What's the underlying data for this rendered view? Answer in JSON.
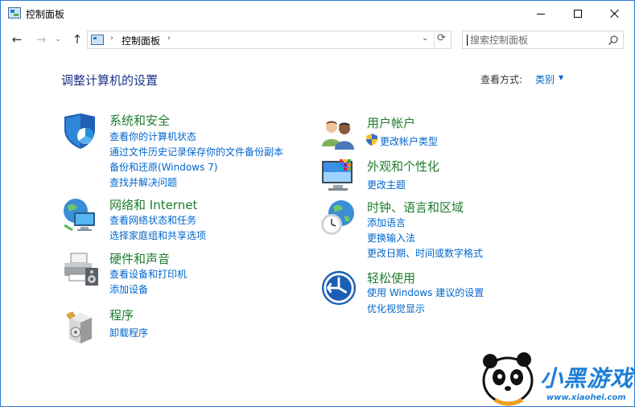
{
  "window": {
    "title": "控制面板"
  },
  "nav": {
    "back": "←",
    "forward": "→",
    "recent": "⌄",
    "up": "↑"
  },
  "address": {
    "separator": "›",
    "crumb": "控制面板",
    "dropdown": "⌄",
    "refresh": "⟳"
  },
  "search": {
    "placeholder": "搜索控制面板"
  },
  "header": {
    "title": "调整计算机的设置",
    "viewby_label": "查看方式:",
    "viewby_value": "类别",
    "viewby_arrow": "▼"
  },
  "categories": [
    {
      "title": "系统和安全",
      "links": [
        "查看你的计算机状态",
        "通过文件历史记录保存你的文件备份副本",
        "备份和还原(Windows 7)",
        "查找并解决问题"
      ]
    },
    {
      "title": "网络和 Internet",
      "links": [
        "查看网络状态和任务",
        "选择家庭组和共享选项"
      ]
    },
    {
      "title": "硬件和声音",
      "links": [
        "查看设备和打印机",
        "添加设备"
      ]
    },
    {
      "title": "程序",
      "links": [
        "卸载程序"
      ]
    },
    {
      "title": "用户帐户",
      "links": [
        "更改帐户类型"
      ]
    },
    {
      "title": "外观和个性化",
      "links": [
        "更改主题"
      ]
    },
    {
      "title": "时钟、语言和区域",
      "links": [
        "添加语言",
        "更换输入法",
        "更改日期、时间或数字格式"
      ]
    },
    {
      "title": "轻松使用",
      "links": [
        "使用 Windows 建议的设置",
        "优化视觉显示"
      ]
    }
  ],
  "watermark": {
    "brand": "小黑游戏",
    "url": "www.xiaohei.com"
  },
  "colors": {
    "title_blue": "#1e3287",
    "category_green": "#1f7d2e",
    "link_blue": "#0066cc",
    "border_blue": "#2b7bd1"
  }
}
